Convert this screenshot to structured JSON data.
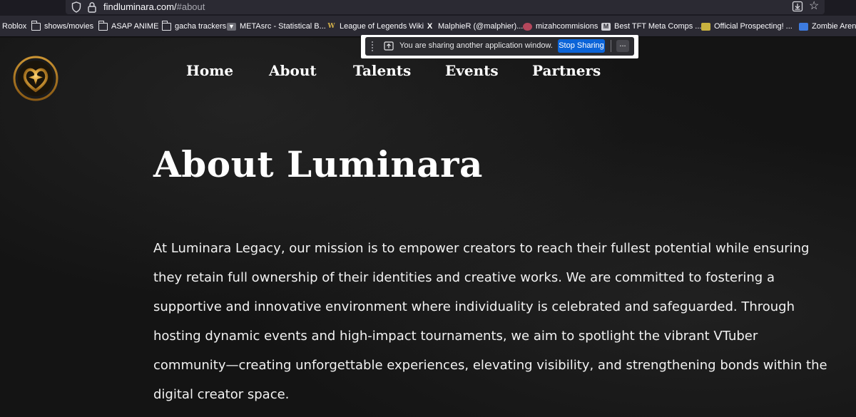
{
  "browser": {
    "url_host": "findluminara.com/",
    "url_hash": "#about",
    "bookmarks": [
      {
        "label": "Roblox",
        "icon": "none"
      },
      {
        "label": "shows/movies",
        "icon": "folder-icon"
      },
      {
        "label": "ASAP ANIME",
        "icon": "folder-icon"
      },
      {
        "label": "gacha trackers",
        "icon": "folder-icon"
      },
      {
        "label": "METAsrc - Statistical B...",
        "icon": "metasrc-icon"
      },
      {
        "label": "League of Legends Wiki",
        "icon": "lol-wiki-icon"
      },
      {
        "label": "MalphieR (@malphier)...",
        "icon": "x-icon"
      },
      {
        "label": "mizahcommisions",
        "icon": "mizah-icon"
      },
      {
        "label": "Best TFT Meta Comps ...",
        "icon": "tft-icon"
      },
      {
        "label": "Official Prospecting! ...",
        "icon": "prospecting-icon"
      },
      {
        "label": "Zombie Arena",
        "icon": "roblox-icon"
      }
    ]
  },
  "sharing_bar": {
    "message": "You are sharing another application window.",
    "stop_label": "Stop Sharing",
    "hide_label": "..."
  },
  "nav": {
    "items": [
      "Home",
      "About",
      "Talents",
      "Events",
      "Partners"
    ]
  },
  "main": {
    "title": "About Luminara",
    "body": "At Luminara Legacy, our mission is to empower creators to reach their fullest potential while ensuring they retain full ownership of their identities and creative works. We are committed to fostering a supportive and innovative environment where individuality is celebrated and safeguarded. Through hosting dynamic events and high-impact tournaments, we aim to spotlight the vibrant VTuber community—creating unforgettable experiences, elevating visibility, and strengthening bonds within the digital creator space."
  },
  "colors": {
    "page_bg": "#141414",
    "logo_gold": "#d9a13a",
    "stop_button": "#0b64d8"
  }
}
